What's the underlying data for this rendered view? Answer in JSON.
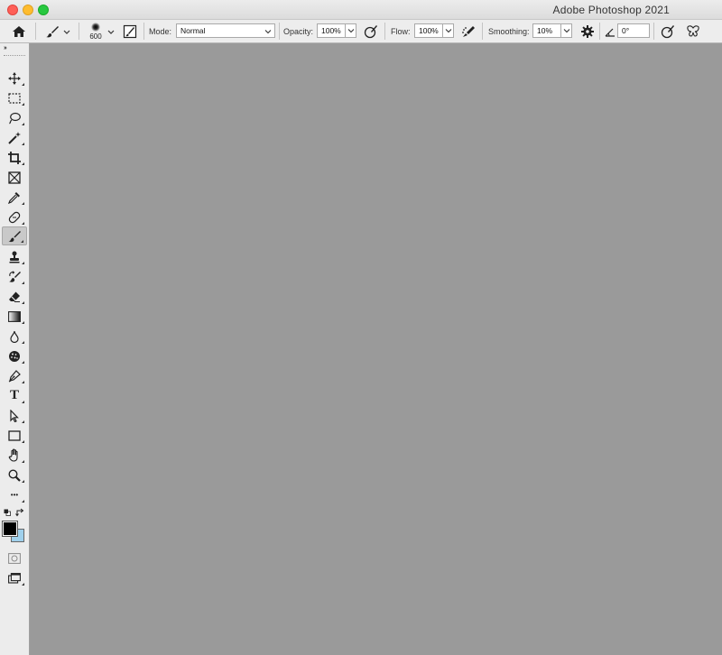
{
  "window": {
    "title": "Adobe Photoshop 2021"
  },
  "options_bar": {
    "brush_size": "600",
    "mode_label": "Mode:",
    "mode_value": "Normal",
    "opacity_label": "Opacity:",
    "opacity_value": "100%",
    "flow_label": "Flow:",
    "flow_value": "100%",
    "smoothing_label": "Smoothing:",
    "smoothing_value": "10%",
    "angle_value": "0°"
  },
  "toolbar": {
    "active_tool": "brush",
    "tools": [
      "move",
      "rectangular-marquee",
      "lasso",
      "magic-wand",
      "crop",
      "frame",
      "eyedropper",
      "spot-healing",
      "brush",
      "clone-stamp",
      "history-brush",
      "eraser",
      "gradient",
      "blur",
      "sponge",
      "pen",
      "type",
      "path-selection",
      "rectangle",
      "hand",
      "zoom",
      "edit-toolbar"
    ],
    "type_tool_glyph": "T",
    "more_tools_glyph": "•••"
  },
  "colors": {
    "foreground": "#000000",
    "background": "#9fd0ec",
    "canvas_bg": "#9a9a9a"
  }
}
